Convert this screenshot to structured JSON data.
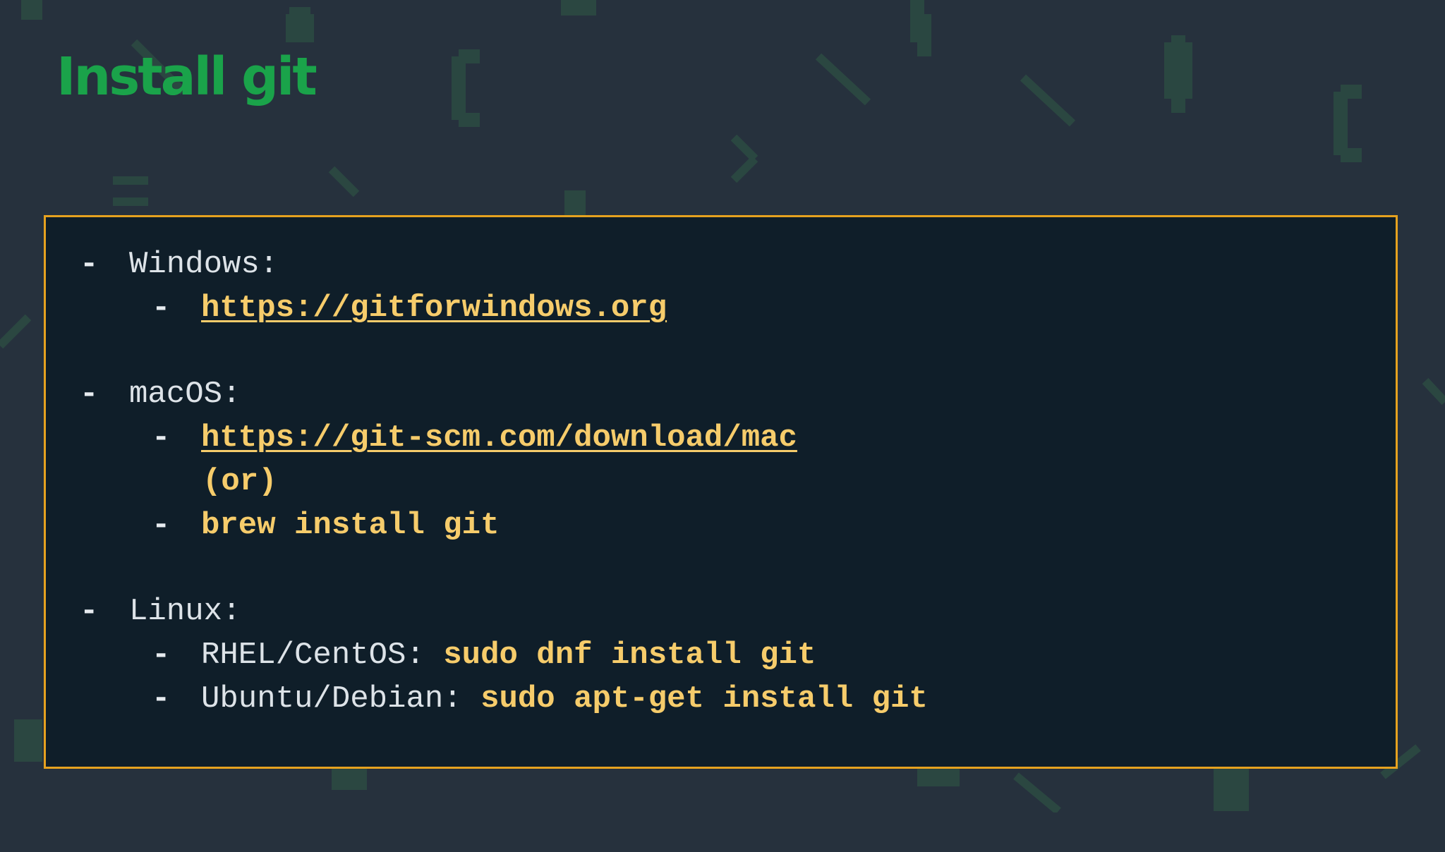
{
  "slide": {
    "title": "Install git"
  },
  "bullet": "-",
  "sections": {
    "windows": {
      "label": "Windows:",
      "link": "https://gitforwindows.org"
    },
    "macos": {
      "label": "macOS:",
      "link": "https://git-scm.com/download/mac",
      "or_text": "(or)",
      "command": "brew install git"
    },
    "linux": {
      "label": "Linux:",
      "rhel_label": "RHEL/CentOS:",
      "rhel_command": "sudo dnf install git",
      "ubuntu_label": "Ubuntu/Debian:",
      "ubuntu_command": "sudo apt-get install git"
    }
  },
  "colors": {
    "background": "#26313d",
    "title": "#1aa34a",
    "panel_border": "#e6a21f",
    "panel_background": "#0f1e29",
    "highlight_text": "#f6cc6b",
    "plain_text": "#dde3e8"
  }
}
